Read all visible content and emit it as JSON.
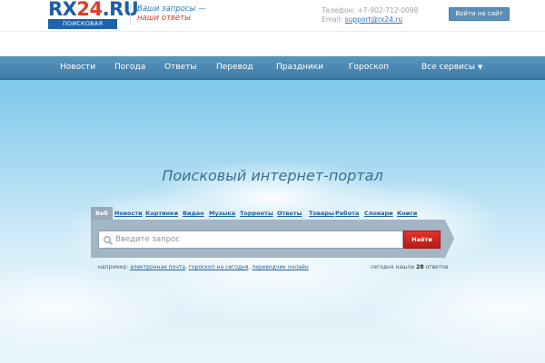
{
  "header": {
    "logo": {
      "part1": "RX",
      "part2": "24",
      "part3": ".RU",
      "subtitle": "ПОИСКОВАЯ СИСТЕМА"
    },
    "slogan": {
      "line1": "Ваши запросы —",
      "line2": "наши ответы"
    },
    "contacts": {
      "phone_label": "Телефон:",
      "phone": "+7-902-712-0098",
      "email_label": "Email:",
      "email": "support@rx24.ru"
    },
    "login_label": "Войти на сайт"
  },
  "nav": {
    "items": [
      "Новости",
      "Погода",
      "Ответы",
      "Перевод",
      "Праздники",
      "Гороскоп",
      "Все сервисы"
    ],
    "arrow": "▼"
  },
  "hero": {
    "title": "Поисковый интернет-портал"
  },
  "search": {
    "tabs": [
      "Веб",
      "Новости",
      "Картинки",
      "Видео",
      "Музыка",
      "Торренты",
      "Ответы",
      "Товары",
      "Работа",
      "Словари",
      "Книги"
    ],
    "placeholder": "Введите запрос",
    "button_label": "Найти",
    "examples_label": "например:",
    "examples": [
      "электронная почта",
      "гороскоп на сегодня",
      "переводчик онлайн"
    ],
    "found_prefix": "сегодня нашли",
    "found_count": "28",
    "found_suffix": "ответов"
  },
  "colors": {
    "nav": "#4a87b1",
    "accent_red": "#d42a22",
    "brand_blue": "#1d5fa6",
    "panel": "#a4b5c3"
  },
  "icons": {
    "search": "magnifier-icon",
    "dropdown": "triangle-down-icon"
  }
}
